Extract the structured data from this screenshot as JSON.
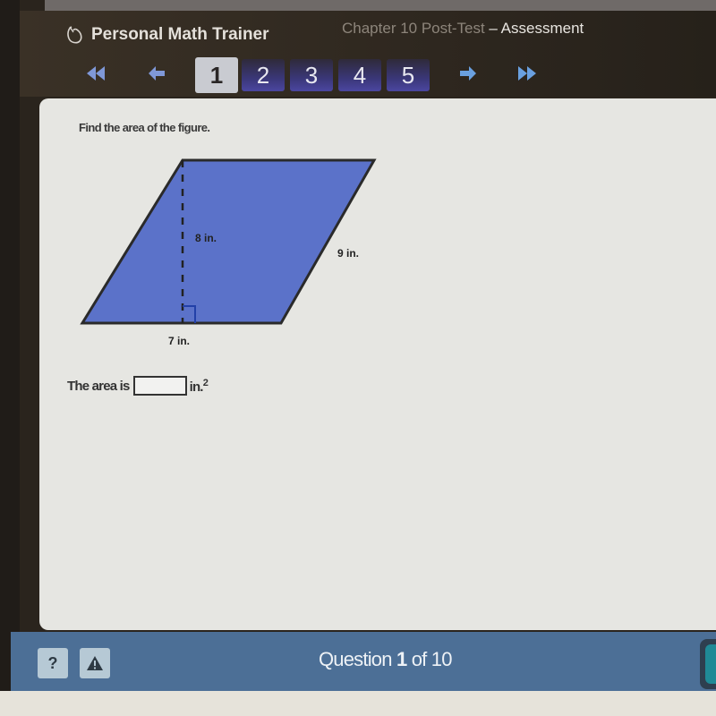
{
  "header": {
    "brand": "Personal Math Trainer",
    "title_prefix": "Chapter 10 Post-Test",
    "title_sep": " – ",
    "title_suffix": "Assessment"
  },
  "nav": {
    "pages": [
      "1",
      "2",
      "3",
      "4",
      "5"
    ],
    "active_page": "1",
    "icons": [
      "first-page-icon",
      "previous-page-icon",
      "next-page-icon",
      "last-page-icon"
    ]
  },
  "question": {
    "prompt": "Find the area of the figure.",
    "figure": {
      "shape": "parallelogram",
      "height_label": "8 in.",
      "side_label": "9 in.",
      "base_label": "7 in.",
      "fill_color": "#5b72c9"
    },
    "answer_prefix": "The area is",
    "answer_value": "",
    "answer_unit": "in.",
    "answer_unit_exp": "2"
  },
  "footer": {
    "help_label": "?",
    "question_word": "Question",
    "question_num": "1",
    "question_of": "of 10"
  }
}
